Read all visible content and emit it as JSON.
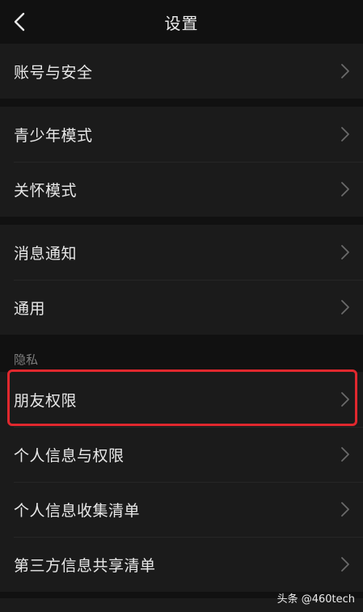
{
  "nav": {
    "title": "设置"
  },
  "groups": [
    {
      "items": [
        "账号与安全"
      ]
    },
    {
      "items": [
        "青少年模式",
        "关怀模式"
      ]
    },
    {
      "items": [
        "消息通知",
        "通用"
      ]
    },
    {
      "items": [
        "朋友权限",
        "个人信息与权限",
        "个人信息收集清单",
        "第三方信息共享清单"
      ]
    }
  ],
  "privacy": {
    "header": "隐私"
  },
  "watermark": "头条 @460tech",
  "colors": {
    "background": "#111111",
    "row": "#1b1b1b",
    "highlight": "#e0282e"
  }
}
